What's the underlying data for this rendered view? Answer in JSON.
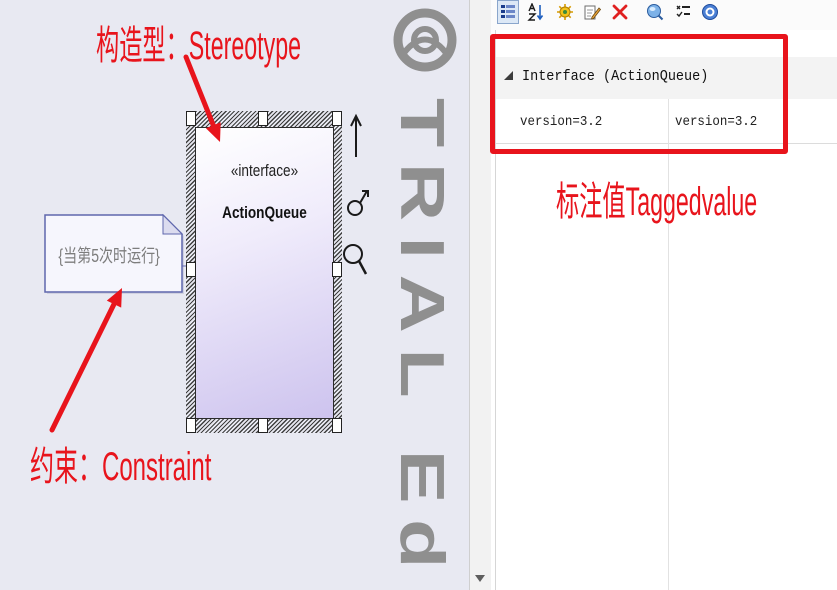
{
  "annotations": {
    "stereotype_label": "构造型：Stereotype",
    "constraint_label": "约束：Constraint",
    "tagged_value_label": "标注值Taggedvalue",
    "color": "#e8141c"
  },
  "diagram": {
    "background": "#e8e9f2",
    "interface_element": {
      "stereotype": "«interface»",
      "name": "ActionQueue",
      "selected": true,
      "fill_end_color": "#cdc3ee"
    },
    "constraint_note": {
      "text": "{当第5次时运行}"
    },
    "quick_linker": {
      "icons": [
        "up-arrow-icon",
        "link-shape-icon",
        "magnifier-icon"
      ]
    },
    "watermark": {
      "text": "TRIAL Ed",
      "logo_icon": "watermark-logo-icon"
    },
    "scrollbar": {
      "down_icon": "scroll-down-arrow-icon"
    }
  },
  "tagged_values_panel": {
    "toolbar": {
      "icons": [
        "categorized-view-icon",
        "sort-alphabetical-icon",
        "new-tag-icon",
        "edit-tag-icon",
        "delete-tag-icon",
        "tag-properties-icon",
        "filter-tags-icon",
        "help-icon"
      ]
    },
    "group": {
      "expander_icon": "collapse-triangle-icon",
      "title": "Interface (ActionQueue)",
      "rows": [
        {
          "tag": "version=3.2",
          "value": "version=3.2"
        }
      ]
    }
  }
}
